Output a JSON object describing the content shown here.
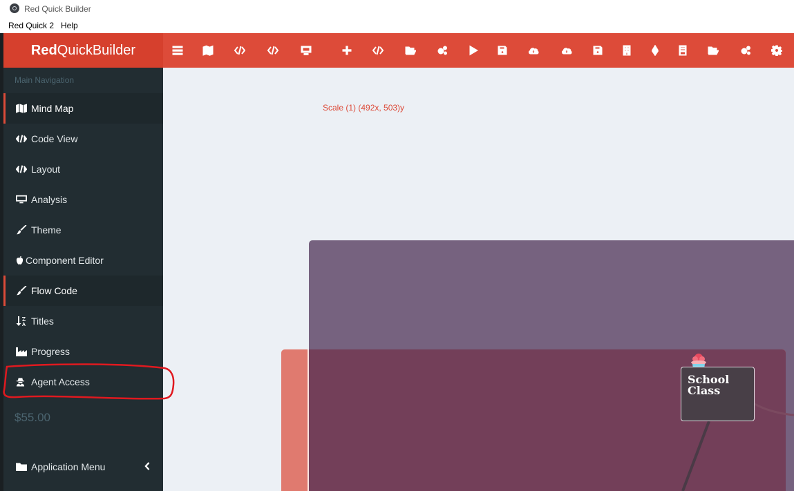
{
  "window": {
    "title": "Red Quick Builder"
  },
  "menubar": {
    "items": [
      "Red Quick 2",
      "Help"
    ]
  },
  "brand": {
    "bold": "Red",
    "rest": "QuickBuilder"
  },
  "toolbar": {
    "icons": [
      "bars-icon",
      "map-icon",
      "code-icon",
      "code-icon",
      "desktop-icon",
      "plus-icon",
      "code-icon",
      "folder-open-icon",
      "cogs-icon",
      "play-icon",
      "save-icon",
      "cloud-upload-icon",
      "cloud-upload-icon",
      "save-icon",
      "building-icon",
      "ethereum-icon",
      "building-icon",
      "folder-open-icon",
      "cogs-icon",
      "cog-icon"
    ]
  },
  "sidebar": {
    "header": "Main Navigation",
    "items": [
      {
        "label": "Mind Map",
        "icon": "map-icon",
        "active": true
      },
      {
        "label": "Code View",
        "icon": "code-icon",
        "active": false
      },
      {
        "label": "Layout",
        "icon": "code-icon",
        "active": false
      },
      {
        "label": "Analysis",
        "icon": "desktop-icon",
        "active": false
      },
      {
        "label": "Theme",
        "icon": "paint-brush-icon",
        "active": false
      },
      {
        "label": "Component Editor",
        "icon": "apple-icon",
        "active": false
      },
      {
        "label": "Flow Code",
        "icon": "paint-brush-icon",
        "active": true
      },
      {
        "label": "Titles",
        "icon": "sort-alpha-icon",
        "active": false
      },
      {
        "label": "Progress",
        "icon": "industry-icon",
        "active": false
      },
      {
        "label": "Agent Access",
        "icon": "user-secret-icon",
        "active": false
      }
    ],
    "price": "$55.00",
    "app_menu": {
      "label": "Application Menu",
      "icon": "folder-icon"
    }
  },
  "canvas": {
    "scale_text": "Scale (1) (492x, 503)y",
    "node": {
      "line1": "School",
      "line2": "Class"
    }
  },
  "colors": {
    "accent": "#dd4b39",
    "brand": "#d6402d",
    "sidebar": "#222d32",
    "annotation": "#e0191f"
  }
}
